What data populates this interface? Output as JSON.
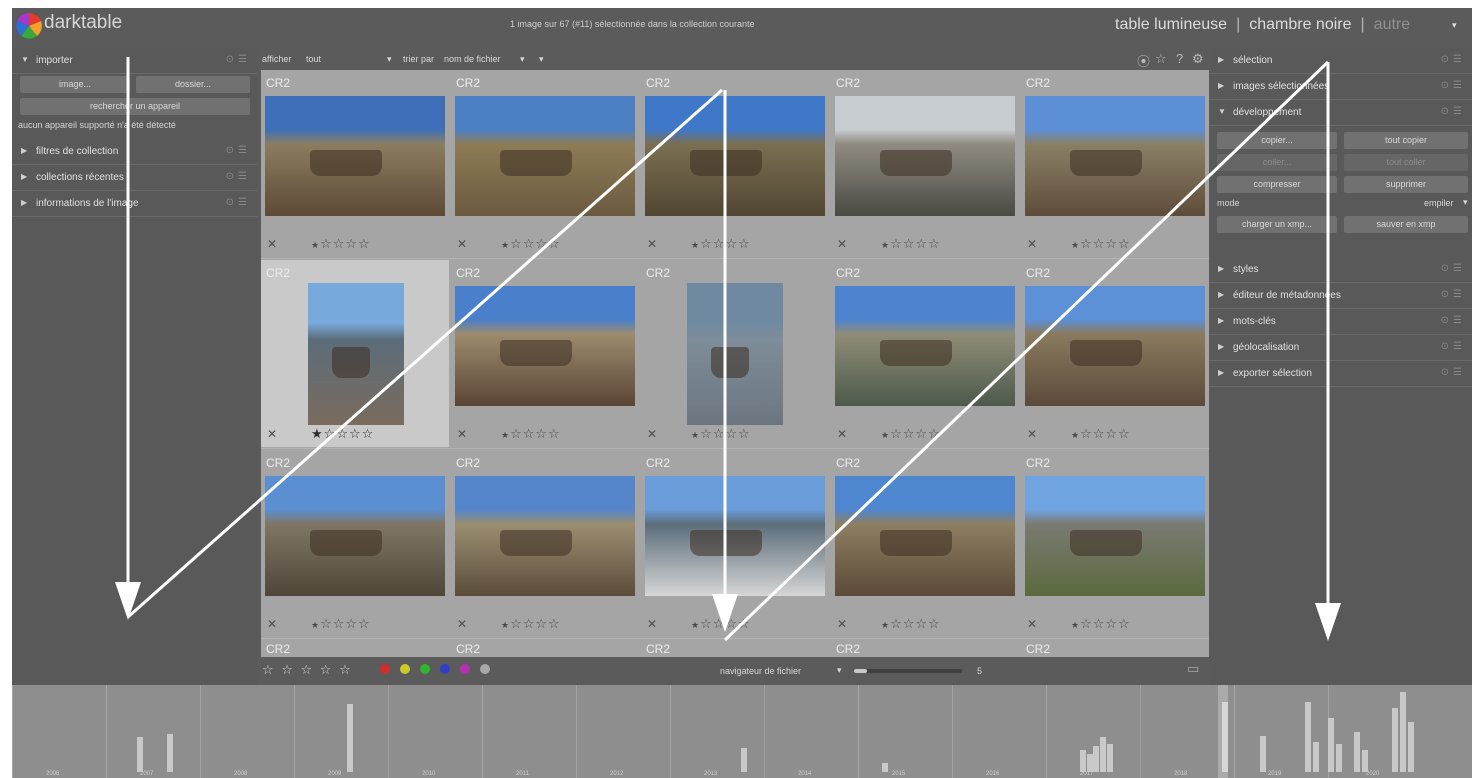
{
  "app": {
    "name": "darktable",
    "logo_icon": "darktable-logo-icon"
  },
  "status": "1 image sur 67 (#11) sélectionnée dans la collection courante",
  "views": {
    "active": "table lumineuse",
    "second": "chambre noire",
    "third": "autre",
    "separator": "|",
    "dropdown_icon": "▾"
  },
  "left_panel": {
    "import": {
      "title": "importer",
      "image_btn": "image...",
      "folder_btn": "dossier...",
      "scan_btn": "rechercher un appareil",
      "no_device": "aucun appareil supporté n'a été détecté"
    },
    "sections": [
      "filtres de collection",
      "collections récentes",
      "informations de l'image"
    ]
  },
  "toolbar": {
    "show_label": "afficher",
    "show_value": "tout",
    "sort_label": "trier par",
    "sort_value": "nom de fichier",
    "sort_dir": "▾",
    "icons": [
      "grouping-icon",
      "star-overlay-icon",
      "help-icon",
      "preferences-icon"
    ],
    "icon_glyphs": [
      "⦿",
      "☆",
      "?",
      "⚙"
    ]
  },
  "grid": {
    "ext": "CR2",
    "reject": "✕",
    "stars": [
      "★",
      "☆",
      "☆",
      "☆",
      "☆"
    ],
    "selected_index": 5,
    "last_row_ext": [
      "CR2",
      "CR2",
      "CR2",
      "CR2",
      "CR2"
    ]
  },
  "bottom_toolbar": {
    "stars": "☆ ☆ ☆ ☆ ☆",
    "color_labels": [
      "#d22d2d",
      "#c9c92a",
      "#2fb52f",
      "#2f3fc9",
      "#b52fb5",
      "#a8a8a8"
    ],
    "nav_label": "navigateur de fichier",
    "zoom_value": "5",
    "zoom_fraction": 0.12
  },
  "right_panel": {
    "sections_top": [
      "sélection",
      "images sélectionnées",
      "développement"
    ],
    "dev": {
      "copy": "copier...",
      "copy_all": "tout copier",
      "paste": "coller...",
      "paste_all": "tout coller",
      "compress": "compresser",
      "delete": "supprimer",
      "mode_label": "mode",
      "mode_value": "empiler",
      "load_xmp": "charger un xmp...",
      "save_xmp": "sauver en xmp"
    },
    "sections_bottom": [
      "styles",
      "éditeur de métadonnées",
      "mots-clés",
      "géolocalisation",
      "exporter sélection"
    ]
  },
  "timeline": {
    "years": [
      "2006",
      "2007",
      "2008",
      "2009",
      "2010",
      "2011",
      "2012",
      "2013",
      "2014",
      "2015",
      "2016",
      "2017",
      "2018",
      "2019",
      "2020"
    ]
  },
  "overlay": {
    "arrow_color": "#ffffff"
  }
}
